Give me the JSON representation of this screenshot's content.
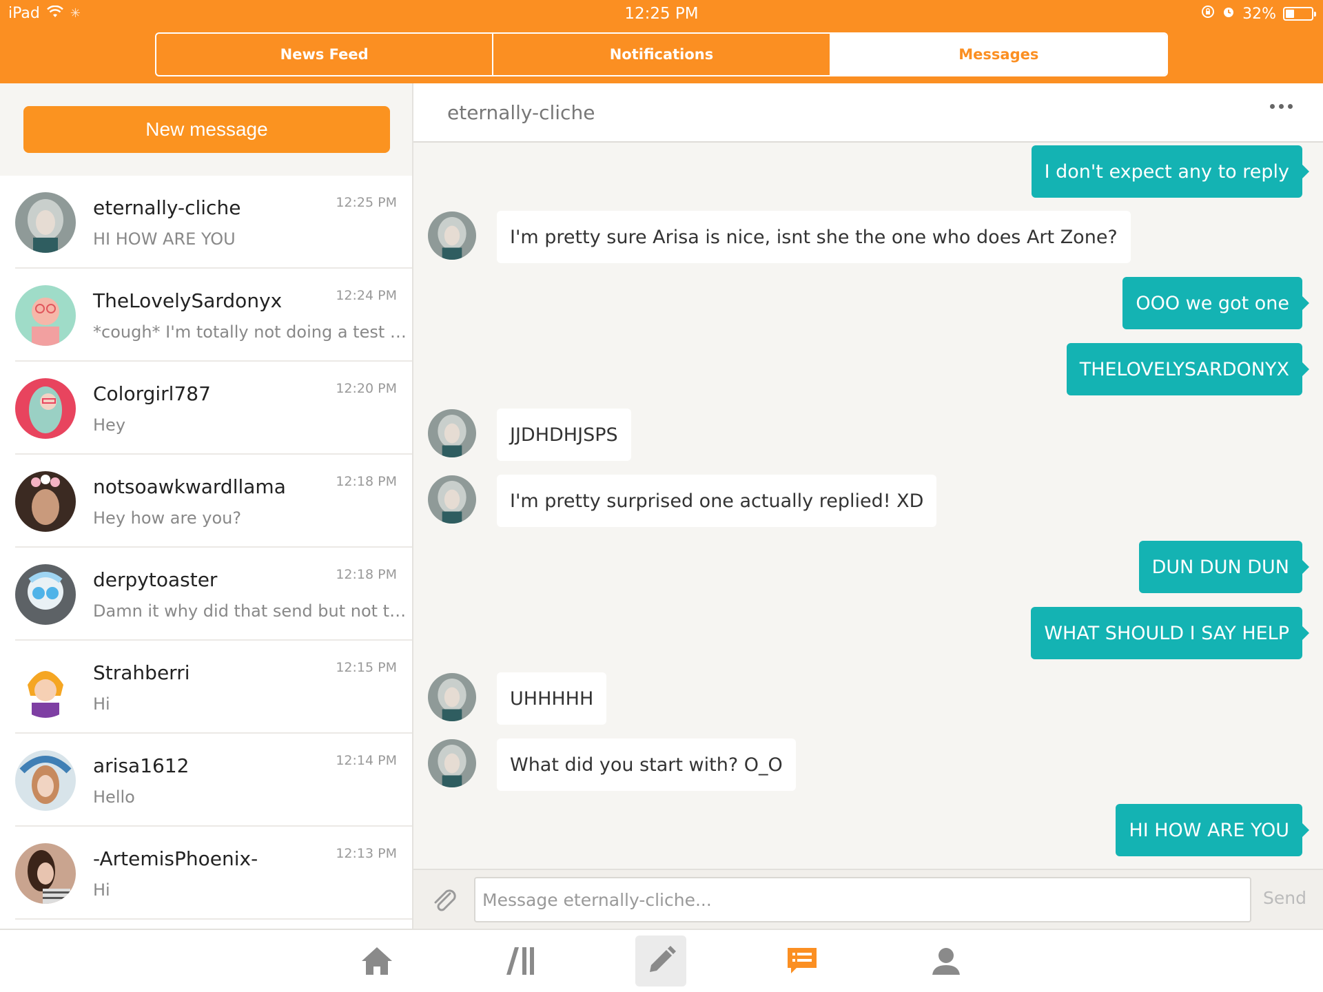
{
  "status_bar": {
    "device": "iPad",
    "time": "12:25 PM",
    "battery": "32%"
  },
  "segments": [
    {
      "label": "News Feed",
      "active": false
    },
    {
      "label": "Notifications",
      "active": false
    },
    {
      "label": "Messages",
      "active": true
    }
  ],
  "sidebar": {
    "new_message_label": "New message",
    "conversations": [
      {
        "name": "eternally-cliche",
        "preview": "HI HOW ARE YOU",
        "time": "12:25 PM"
      },
      {
        "name": "TheLovelySardonyx",
        "preview": "*cough* I'm totally not doing a test to see if any of y'all will reply",
        "time": "12:24 PM"
      },
      {
        "name": "Colorgirl787",
        "preview": "Hey",
        "time": "12:20 PM"
      },
      {
        "name": "notsoawkwardllama",
        "preview": "Hey how are you?",
        "time": "12:18 PM"
      },
      {
        "name": "derpytoaster",
        "preview": "Damn it why did that send but not the other one",
        "time": "12:18 PM"
      },
      {
        "name": "Strahberri",
        "preview": "Hi",
        "time": "12:15 PM"
      },
      {
        "name": "arisa1612",
        "preview": "Hello",
        "time": "12:14 PM"
      },
      {
        "name": "-ArtemisPhoenix-",
        "preview": "Hi",
        "time": "12:13 PM"
      }
    ]
  },
  "chat": {
    "title": "eternally-cliche",
    "messages": [
      {
        "direction": "out",
        "text": "I don't expect any to reply"
      },
      {
        "direction": "in",
        "text": "I'm pretty sure Arisa is nice, isnt she the one who does Art Zone?"
      },
      {
        "direction": "out",
        "text": "OOO we got one"
      },
      {
        "direction": "out",
        "text": "THELOVELYSARDONYX"
      },
      {
        "direction": "in",
        "text": "JJDHDHJSPS"
      },
      {
        "direction": "in",
        "text": "I'm pretty surprised one actually replied! XD"
      },
      {
        "direction": "out",
        "text": "DUN DUN DUN"
      },
      {
        "direction": "out",
        "text": "WHAT SHOULD I SAY HELP"
      },
      {
        "direction": "in",
        "text": "UHHHHH"
      },
      {
        "direction": "in",
        "text": "What did you start with? O_O"
      },
      {
        "direction": "out",
        "text": "HI HOW ARE YOU"
      }
    ],
    "composer": {
      "placeholder": "Message eternally-cliche...",
      "send_label": "Send"
    }
  },
  "tabbar": [
    {
      "icon": "home-icon"
    },
    {
      "icon": "explore-icon"
    },
    {
      "icon": "compose-pencil-icon"
    },
    {
      "icon": "messages-icon"
    },
    {
      "icon": "profile-icon"
    }
  ],
  "colors": {
    "brand_orange": "#fb8f22",
    "outgoing_bubble": "#14b3b3"
  }
}
